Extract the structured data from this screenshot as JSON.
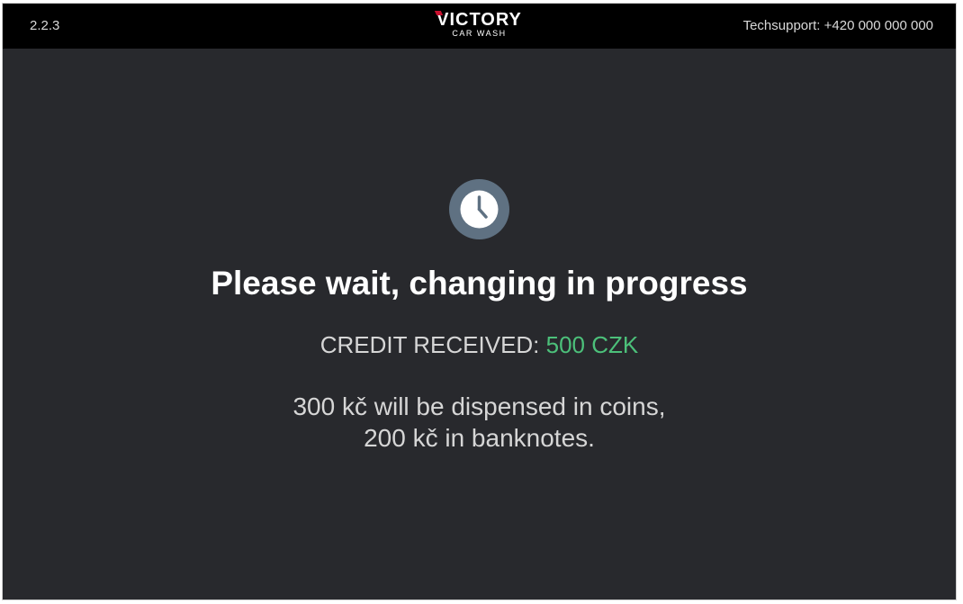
{
  "header": {
    "version": "2.2.3",
    "logo_main_first": "V",
    "logo_main_rest": "ICTORY",
    "logo_sub": "CAR WASH",
    "support": "Techsupport: +420 000 000 000"
  },
  "main": {
    "status_icon": "clock-icon",
    "headline": "Please wait, changing in progress",
    "credit_label": "CREDIT RECEIVED: ",
    "credit_amount": "500 CZK",
    "dispense_line1": "300 kč will be dispensed in coins,",
    "dispense_line2": "200 kč in banknotes."
  },
  "colors": {
    "background": "#28292d",
    "topbar": "#000000",
    "accent_green": "#4cc07a",
    "logo_red": "#c8102e",
    "clock_ring": "#5f7182"
  }
}
